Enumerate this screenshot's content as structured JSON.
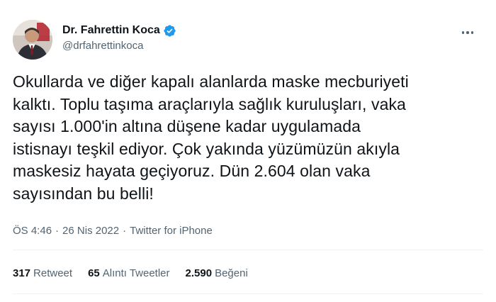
{
  "author": {
    "display_name": "Dr. Fahrettin Koca",
    "handle": "@drfahrettinkoca",
    "verified": true,
    "avatar_icon": "profile-photo"
  },
  "tweet": {
    "text": "Okullarda ve diğer kapalı alanlarda maske mecburiyeti\nkalktı. Toplu taşıma araçlarıyla sağlık kuruluşları, vaka\nsayısı 1.000'in altına düşene kadar uygulamada\nistisnayı teşkil ediyor. Çok yakında yüzümüzün akıyla\nmaskesiz hayata geçiyoruz. Dün 2.604 olan vaka\nsayısından bu belli!"
  },
  "meta": {
    "time": "ÖS 4:46",
    "separator": "·",
    "date": "26 Nis 2022",
    "source": "Twitter for iPhone"
  },
  "stats": {
    "retweets": {
      "count": "317",
      "label": "Retweet"
    },
    "quotes": {
      "count": "65",
      "label": "Alıntı Tweetler"
    },
    "likes": {
      "count": "2.590",
      "label": "Beğeni"
    }
  },
  "colors": {
    "text": "#0f1419",
    "secondary": "#536471",
    "verified": "#1d9bf0",
    "divider": "#eff3f4"
  }
}
